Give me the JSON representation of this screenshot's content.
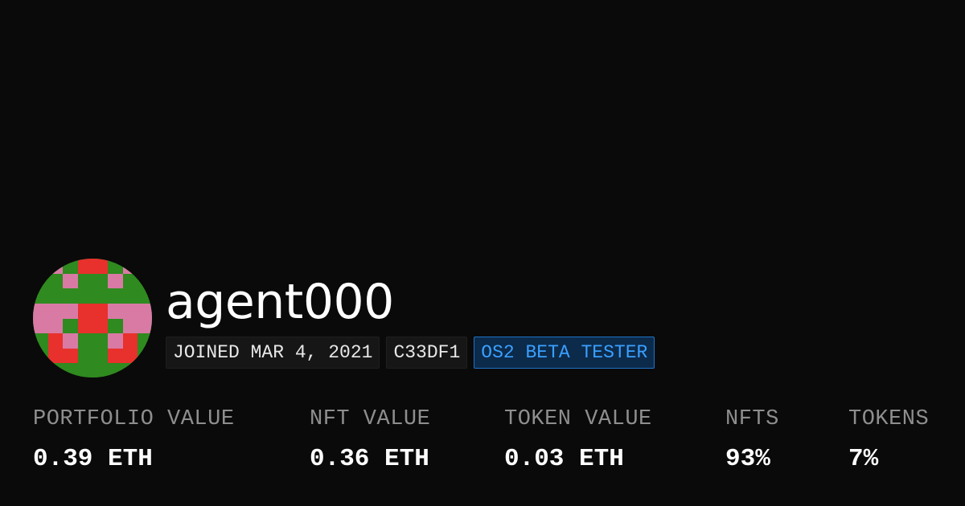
{
  "profile": {
    "username": "agent000",
    "badges": {
      "joined": "JOINED MAR 4, 2021",
      "address": "C33DF1",
      "beta": "OS2 BETA TESTER"
    }
  },
  "stats": [
    {
      "label": "PORTFOLIO VALUE",
      "value": "0.39 ETH"
    },
    {
      "label": "NFT VALUE",
      "value": "0.36 ETH"
    },
    {
      "label": "TOKEN VALUE",
      "value": "0.03 ETH"
    },
    {
      "label": "NFTS",
      "value": "93%"
    },
    {
      "label": "TOKENS",
      "value": "7%"
    }
  ],
  "colors": {
    "background": "#0a0a0a",
    "label": "#8e8e8e",
    "beta_text": "#3aa0ff",
    "beta_border": "#1e74c8",
    "avatar_green": "#2f8a1f",
    "avatar_pink": "#d97aa5",
    "avatar_red": "#e8302c"
  },
  "avatar": {
    "icon": "pixel-identicon"
  }
}
